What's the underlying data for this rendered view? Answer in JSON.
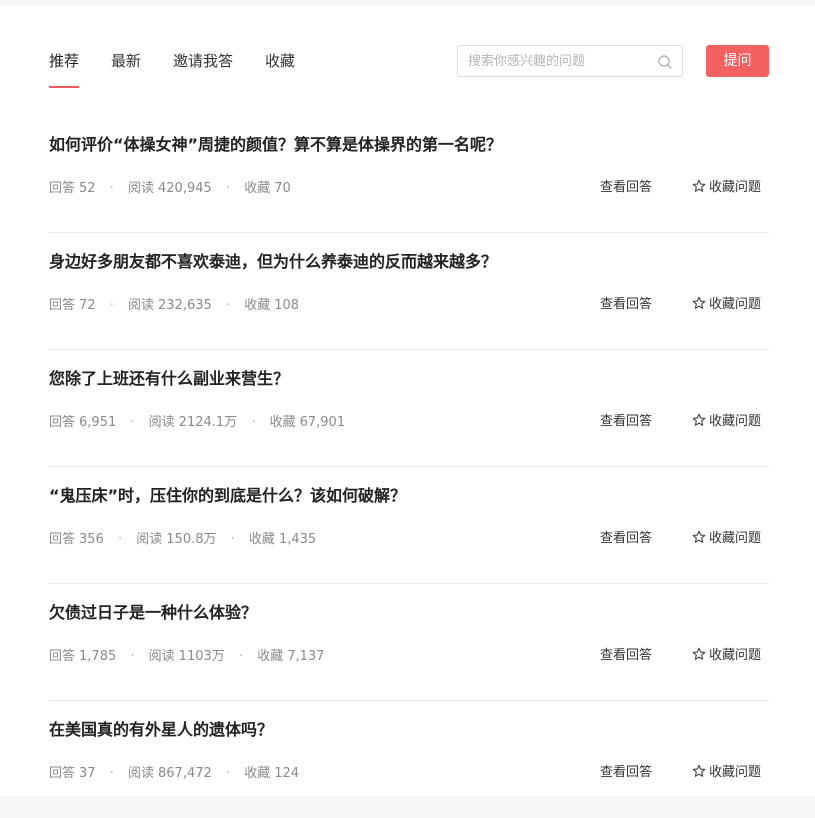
{
  "tabs": [
    {
      "label": "推荐",
      "active": true
    },
    {
      "label": "最新",
      "active": false
    },
    {
      "label": "邀请我答",
      "active": false
    },
    {
      "label": "收藏",
      "active": false
    }
  ],
  "search": {
    "placeholder": "搜索你感兴趣的问题",
    "icon": "search-icon"
  },
  "ask_button": "提问",
  "labels": {
    "answers": "回答",
    "reads": "阅读",
    "favorites": "收藏",
    "separator": "·",
    "view_answers": "查看回答",
    "fav_question": "收藏问题"
  },
  "questions": [
    {
      "title": "如何评价“体操女神”周捷的颜值？算不算是体操界的第一名呢？",
      "answers": "52",
      "reads": "420,945",
      "favorites": "70"
    },
    {
      "title": "身边好多朋友都不喜欢泰迪，但为什么养泰迪的反而越来越多？",
      "answers": "72",
      "reads": "232,635",
      "favorites": "108"
    },
    {
      "title": "您除了上班还有什么副业来营生？",
      "answers": "6,951",
      "reads": "2124.1万",
      "favorites": "67,901"
    },
    {
      "title": "“鬼压床”时，压住你的到底是什么？该如何破解？",
      "answers": "356",
      "reads": "150.8万",
      "favorites": "1,435"
    },
    {
      "title": "欠债过日子是一种什么体验？",
      "answers": "1,785",
      "reads": "1103万",
      "favorites": "7,137"
    },
    {
      "title": "在美国真的有外星人的遗体吗？",
      "answers": "37",
      "reads": "867,472",
      "favorites": "124"
    }
  ],
  "colors": {
    "accent": "#f46161",
    "tab_underline": "#ef5a5a"
  }
}
